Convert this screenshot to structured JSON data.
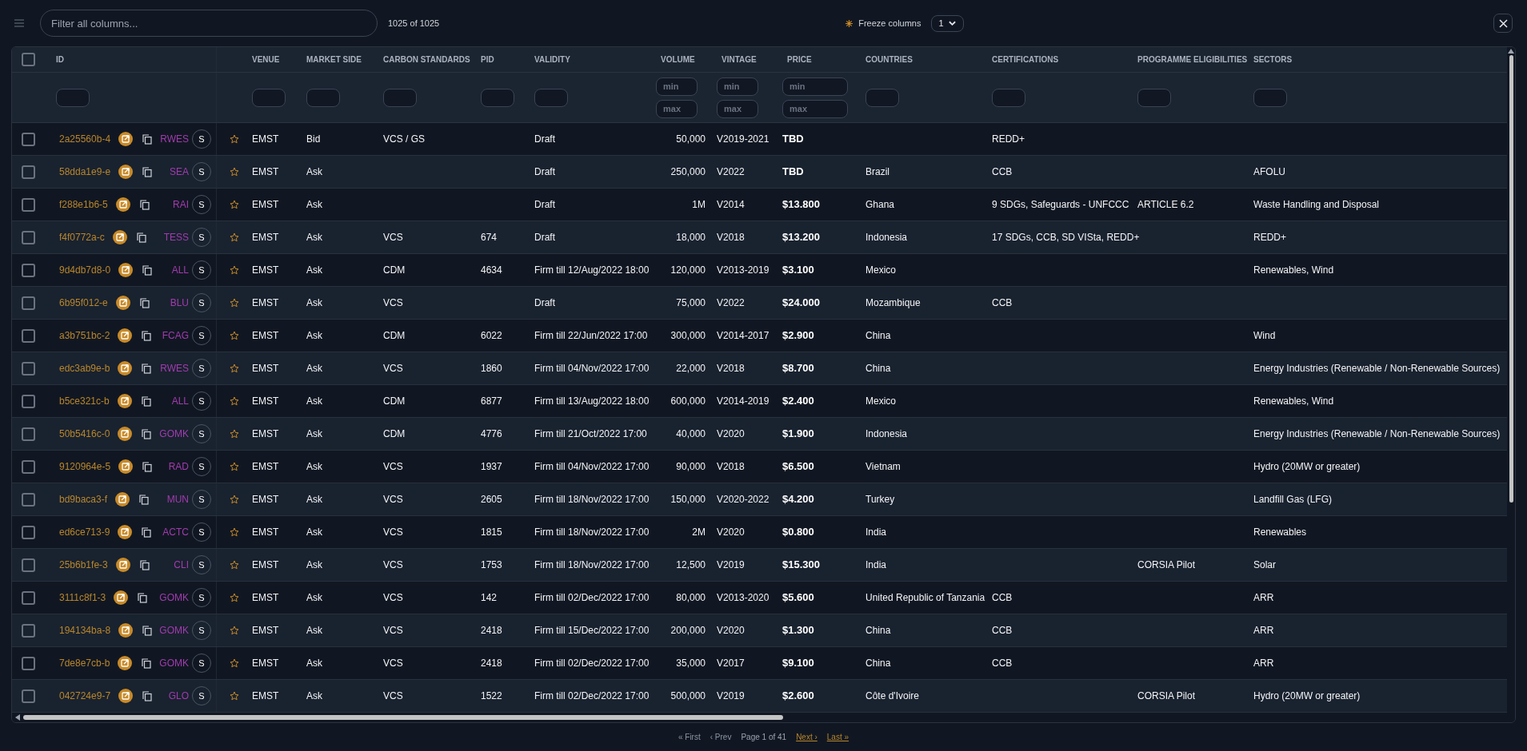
{
  "toolbar": {
    "search": {
      "placeholder": "Filter all columns..."
    },
    "count": "1025 of 1025",
    "freeze": {
      "label": "Freeze columns",
      "value": "1"
    }
  },
  "table": {
    "select_all_checked": false,
    "columns": [
      {
        "label": "ID",
        "kind": "text"
      },
      {
        "label": "VENUE",
        "kind": "text"
      },
      {
        "label": "MARKET SIDE",
        "kind": "text"
      },
      {
        "label": "CARBON STANDARDS",
        "kind": "text"
      },
      {
        "label": "PID",
        "kind": "text"
      },
      {
        "label": "VALIDITY",
        "kind": "text"
      },
      {
        "label": "VOLUME",
        "kind": "range",
        "min_placeholder": "min",
        "max_placeholder": "max"
      },
      {
        "label": "VINTAGE",
        "kind": "range",
        "min_placeholder": "min",
        "max_placeholder": "max"
      },
      {
        "label": "PRICE",
        "kind": "range",
        "min_placeholder": "min",
        "max_placeholder": "max"
      },
      {
        "label": "COUNTRIES",
        "kind": "text"
      },
      {
        "label": "CERTIFICATIONS",
        "kind": "text"
      },
      {
        "label": "PROGRAMME ELIGIBILITIES",
        "kind": "text"
      },
      {
        "label": "SECTORS",
        "kind": "text"
      }
    ],
    "rows": [
      {
        "checked": false,
        "starred": false,
        "code": "RWES",
        "avatar": "S",
        "cells": [
          "2a25560b-4",
          "EMST",
          "Bid",
          "VCS / GS",
          "",
          "Draft",
          "50,000",
          "V2019-2021",
          "TBD",
          "",
          "REDD+",
          "",
          ""
        ]
      },
      {
        "checked": false,
        "starred": false,
        "code": "SEA",
        "avatar": "S",
        "cells": [
          "58dda1e9-e",
          "EMST",
          "Ask",
          "",
          "",
          "Draft",
          "250,000",
          "V2022",
          "TBD",
          "Brazil",
          "CCB",
          "",
          "AFOLU"
        ]
      },
      {
        "checked": false,
        "starred": false,
        "code": "RAI",
        "avatar": "S",
        "cells": [
          "f288e1b6-5",
          "EMST",
          "Ask",
          "",
          "",
          "Draft",
          "1M",
          "V2014",
          "$13.800",
          "Ghana",
          "9 SDGs, Safeguards - UNFCCC",
          "ARTICLE 6.2",
          "Waste Handling and Disposal"
        ]
      },
      {
        "checked": false,
        "starred": false,
        "code": "TESS",
        "avatar": "S",
        "cells": [
          "f4f0772a-c",
          "EMST",
          "Ask",
          "VCS",
          "674",
          "Draft",
          "18,000",
          "V2018",
          "$13.200",
          "Indonesia",
          "17 SDGs, CCB, SD VISta, REDD+",
          "",
          "REDD+"
        ]
      },
      {
        "checked": false,
        "starred": false,
        "code": "ALL",
        "avatar": "S",
        "cells": [
          "9d4db7d8-0",
          "EMST",
          "Ask",
          "CDM",
          "4634",
          "Firm till 12/Aug/2022 18:00",
          "120,000",
          "V2013-2019",
          "$3.100",
          "Mexico",
          "",
          "",
          "Renewables, Wind"
        ]
      },
      {
        "checked": false,
        "starred": false,
        "code": "BLU",
        "avatar": "S",
        "cells": [
          "6b95f012-e",
          "EMST",
          "Ask",
          "VCS",
          "",
          "Draft",
          "75,000",
          "V2022",
          "$24.000",
          "Mozambique",
          "CCB",
          "",
          ""
        ]
      },
      {
        "checked": false,
        "starred": false,
        "code": "FCAG",
        "avatar": "S",
        "cells": [
          "a3b751bc-2",
          "EMST",
          "Ask",
          "CDM",
          "6022",
          "Firm till 22/Jun/2022 17:00",
          "300,000",
          "V2014-2017",
          "$2.900",
          "China",
          "",
          "",
          "Wind"
        ]
      },
      {
        "checked": false,
        "starred": false,
        "code": "RWES",
        "avatar": "S",
        "cells": [
          "edc3ab9e-b",
          "EMST",
          "Ask",
          "VCS",
          "1860",
          "Firm till 04/Nov/2022 17:00",
          "22,000",
          "V2018",
          "$8.700",
          "China",
          "",
          "",
          "Energy Industries (Renewable / Non-Renewable Sources)"
        ]
      },
      {
        "checked": false,
        "starred": false,
        "code": "ALL",
        "avatar": "S",
        "cells": [
          "b5ce321c-b",
          "EMST",
          "Ask",
          "CDM",
          "6877",
          "Firm till 13/Aug/2022 18:00",
          "600,000",
          "V2014-2019",
          "$2.400",
          "Mexico",
          "",
          "",
          "Renewables, Wind"
        ]
      },
      {
        "checked": false,
        "starred": false,
        "code": "GOMK",
        "avatar": "S",
        "cells": [
          "50b5416c-0",
          "EMST",
          "Ask",
          "CDM",
          "4776",
          "Firm till 21/Oct/2022 17:00",
          "40,000",
          "V2020",
          "$1.900",
          "Indonesia",
          "",
          "",
          "Energy Industries (Renewable / Non-Renewable Sources)"
        ]
      },
      {
        "checked": false,
        "starred": false,
        "code": "RAD",
        "avatar": "S",
        "cells": [
          "9120964e-5",
          "EMST",
          "Ask",
          "VCS",
          "1937",
          "Firm till 04/Nov/2022 17:00",
          "90,000",
          "V2018",
          "$6.500",
          "Vietnam",
          "",
          "",
          "Hydro (20MW or greater)"
        ]
      },
      {
        "checked": false,
        "starred": false,
        "code": "MUN",
        "avatar": "S",
        "cells": [
          "bd9baca3-f",
          "EMST",
          "Ask",
          "VCS",
          "2605",
          "Firm till 18/Nov/2022 17:00",
          "150,000",
          "V2020-2022",
          "$4.200",
          "Turkey",
          "",
          "",
          "Landfill Gas (LFG)"
        ]
      },
      {
        "checked": false,
        "starred": false,
        "code": "ACTC",
        "avatar": "S",
        "cells": [
          "ed6ce713-9",
          "EMST",
          "Ask",
          "VCS",
          "1815",
          "Firm till 18/Nov/2022 17:00",
          "2M",
          "V2020",
          "$0.800",
          "India",
          "",
          "",
          "Renewables"
        ]
      },
      {
        "checked": false,
        "starred": false,
        "code": "CLI",
        "avatar": "S",
        "cells": [
          "25b6b1fe-3",
          "EMST",
          "Ask",
          "VCS",
          "1753",
          "Firm till 18/Nov/2022 17:00",
          "12,500",
          "V2019",
          "$15.300",
          "India",
          "",
          "CORSIA Pilot",
          "Solar"
        ]
      },
      {
        "checked": false,
        "starred": false,
        "code": "GOMK",
        "avatar": "S",
        "cells": [
          "3111c8f1-3",
          "EMST",
          "Ask",
          "VCS",
          "142",
          "Firm till 02/Dec/2022 17:00",
          "80,000",
          "V2013-2020",
          "$5.600",
          "United Republic of Tanzania",
          "CCB",
          "",
          "ARR"
        ]
      },
      {
        "checked": false,
        "starred": false,
        "code": "GOMK",
        "avatar": "S",
        "cells": [
          "194134ba-8",
          "EMST",
          "Ask",
          "VCS",
          "2418",
          "Firm till 15/Dec/2022 17:00",
          "200,000",
          "V2020",
          "$1.300",
          "China",
          "CCB",
          "",
          "ARR"
        ]
      },
      {
        "checked": false,
        "starred": false,
        "code": "GOMK",
        "avatar": "S",
        "cells": [
          "7de8e7cb-b",
          "EMST",
          "Ask",
          "VCS",
          "2418",
          "Firm till 02/Dec/2022 17:00",
          "35,000",
          "V2017",
          "$9.100",
          "China",
          "CCB",
          "",
          "ARR"
        ]
      },
      {
        "checked": false,
        "starred": false,
        "code": "GLO",
        "avatar": "S",
        "cells": [
          "042724e9-7",
          "EMST",
          "Ask",
          "VCS",
          "1522",
          "Firm till 02/Dec/2022 17:00",
          "500,000",
          "V2019",
          "$2.600",
          "Côte d'Ivoire",
          "",
          "CORSIA Pilot",
          "Hydro (20MW or greater)"
        ]
      }
    ]
  },
  "pagination": [
    {
      "kind": "link",
      "label": "« First",
      "disabled": true
    },
    {
      "kind": "link",
      "label": "‹ Prev",
      "disabled": true
    },
    {
      "kind": "text",
      "label": "Page 1 of 41"
    },
    {
      "kind": "link",
      "label": "Next ›",
      "disabled": false
    },
    {
      "kind": "link",
      "label": "Last »",
      "disabled": false
    }
  ]
}
